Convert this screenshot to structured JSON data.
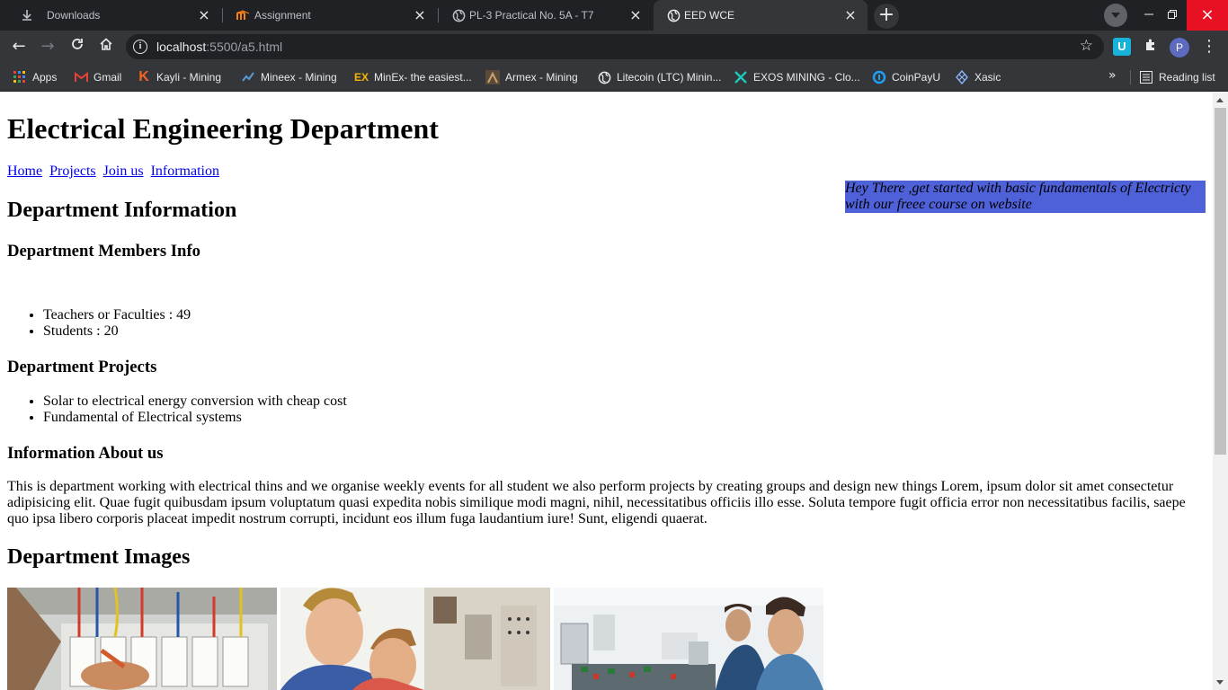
{
  "browser": {
    "tabs": [
      {
        "title": "Downloads",
        "icon": "download-icon",
        "active": false
      },
      {
        "title": "Assignment",
        "icon": "moodle-icon",
        "active": false
      },
      {
        "title": "PL-3 Practical No. 5A - T7",
        "icon": "globe-icon",
        "active": false
      },
      {
        "title": "EED WCE",
        "icon": "globe-icon",
        "active": true
      }
    ],
    "address": {
      "host": "localhost",
      "rest": ":5500/a5.html"
    },
    "profile_initial": "P",
    "extension_label": "U",
    "bookmarks": [
      {
        "label": "Apps",
        "icon": "apps-grid-icon"
      },
      {
        "label": "Gmail",
        "icon": "gmail-icon"
      },
      {
        "label": "Kayli - Mining",
        "icon": "kayli-icon"
      },
      {
        "label": "Mineex - Mining",
        "icon": "mineex-icon"
      },
      {
        "label": "MinEx- the easiest...",
        "icon": "minex-icon"
      },
      {
        "label": "Armex - Mining",
        "icon": "armex-icon"
      },
      {
        "label": "Litecoin (LTC) Minin...",
        "icon": "globe-icon"
      },
      {
        "label": "EXOS MINING - Clo...",
        "icon": "exos-icon"
      },
      {
        "label": "CoinPayU",
        "icon": "coinpayu-icon"
      },
      {
        "label": "Xasic",
        "icon": "xasic-icon"
      }
    ],
    "reading_list": "Reading list",
    "colors": {
      "chrome_dark": "#202124",
      "chrome_toolbar": "#35363a",
      "close_red": "#e81123"
    }
  },
  "page": {
    "title": "Electrical Engineering Department",
    "nav": [
      "Home",
      "Projects",
      "Join us",
      "Information"
    ],
    "marquee_text": "Hey There ,get started with basic fundamentals of Electricty with our freee course on website",
    "marquee_color": "#4e61d8",
    "info_heading": "Department Information",
    "members_heading": "Department Members Info",
    "members": [
      "Teachers or Faculties : 49",
      "Students : 20"
    ],
    "projects_heading": "Department Projects",
    "projects": [
      "Solar to electrical energy conversion with cheap cost",
      "Fundamental of Electrical systems"
    ],
    "about_heading": "Information About us",
    "about_text": "This is department working with electrical thins and we organise weekly events for all student we also perform projects by creating groups and design new things Lorem, ipsum dolor sit amet consectetur adipisicing elit. Quae fugit quibusdam ipsum voluptatum quasi expedita nobis similique modi magni, nihil, necessitatibus officiis illo esse. Soluta tempore fugit officia error non necessitatibus facilis, saepe quo ipsa libero corporis placeat impedit nostrum corrupti, incidunt eos illum fuga laudantium iure! Sunt, eligendi quaerat.",
    "images_heading": "Department Images"
  }
}
